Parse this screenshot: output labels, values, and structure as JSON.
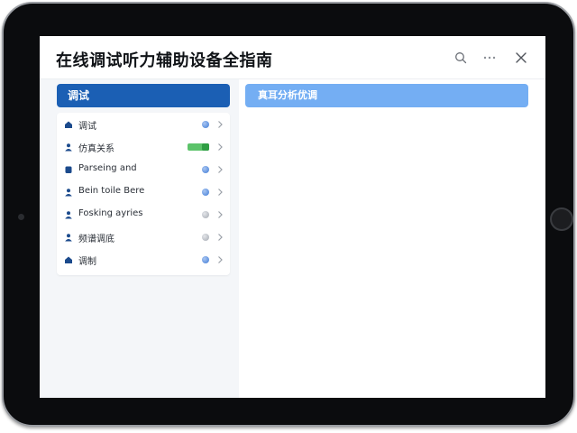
{
  "app": {
    "title": "在线调试听力辅助设备全指南"
  },
  "header": {
    "search_icon": "search-icon",
    "more_icon": "more-icon",
    "close_icon": "close-icon"
  },
  "left_panel": {
    "header_label": "调试",
    "items": [
      {
        "label": "调试",
        "icon": "home-icon",
        "indicator": "dot"
      },
      {
        "label": "仿真关系",
        "icon": "person-icon",
        "indicator": "toggle",
        "toggle_on": true
      },
      {
        "label": "Parseing and",
        "icon": "device-icon",
        "indicator": "dot"
      },
      {
        "label": "Bein toile Bere",
        "icon": "person-icon",
        "indicator": "dot"
      },
      {
        "label": "Fosking ayries",
        "icon": "person-icon",
        "indicator": "dot-grey"
      },
      {
        "label": "频谱调底",
        "icon": "person-icon",
        "indicator": "dot-grey"
      },
      {
        "label": "调制",
        "icon": "home-icon",
        "indicator": "dot"
      }
    ]
  },
  "right_panel": {
    "header_label": "真耳分析优调"
  },
  "colors": {
    "accent": "#1b5fb4",
    "accent_light": "#74aef3",
    "toggle_on": "#5cc36a",
    "background": "#f4f6f9",
    "frame": "#0b0c0e"
  }
}
